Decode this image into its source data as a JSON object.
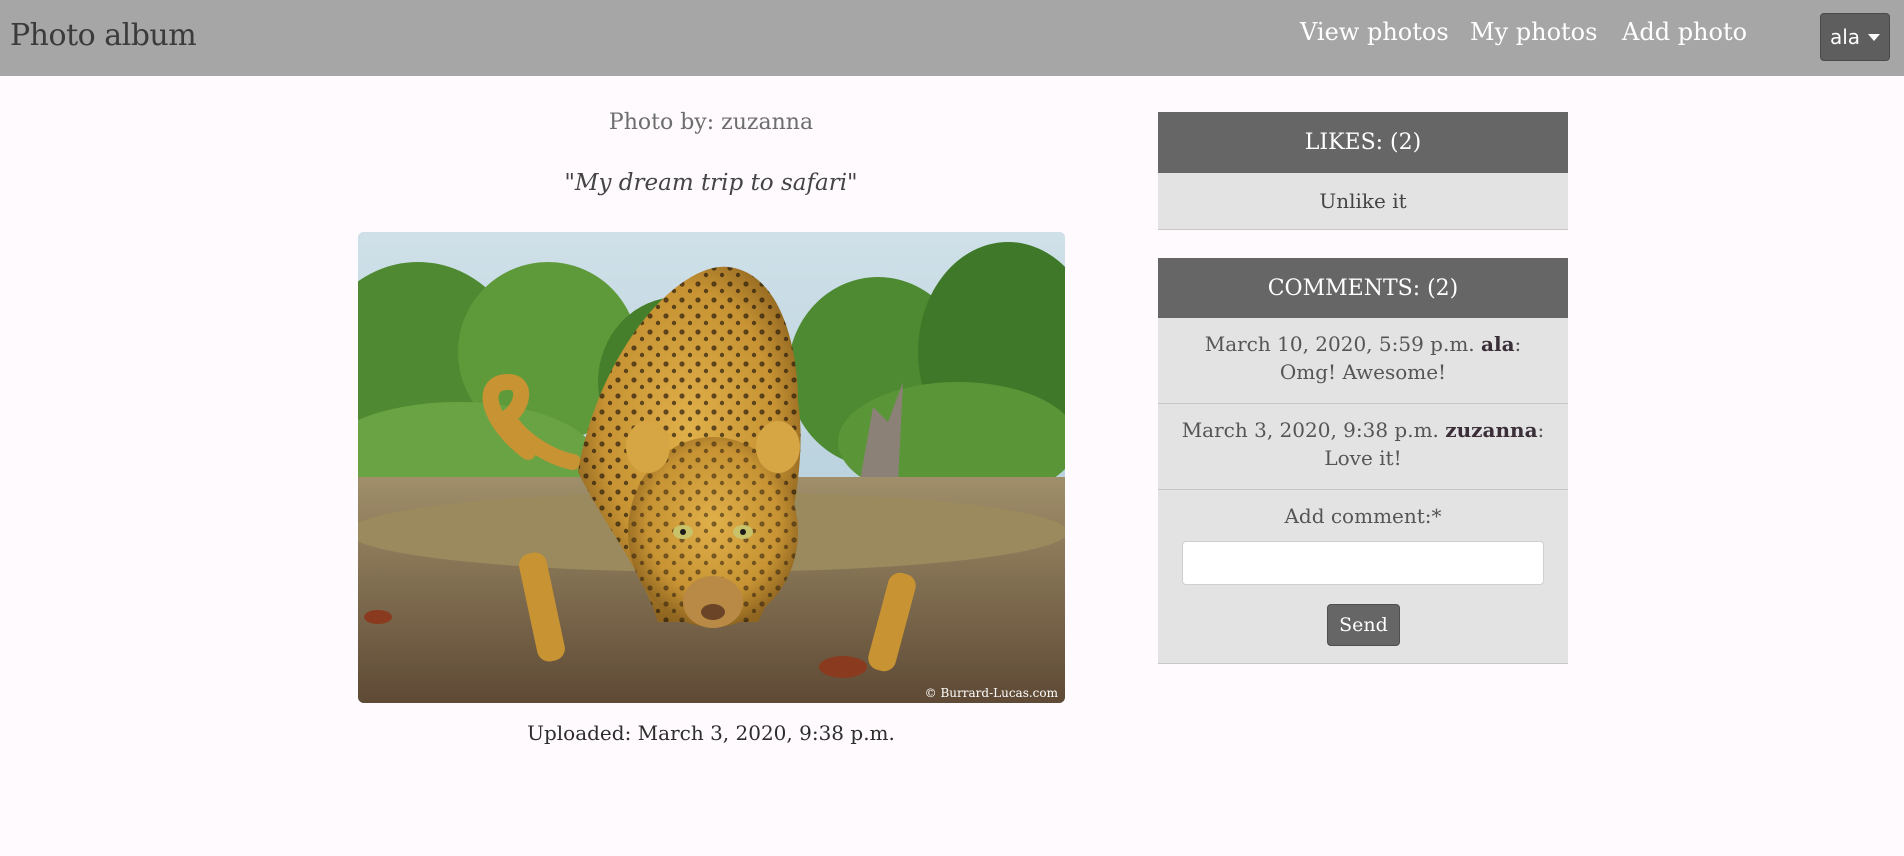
{
  "navbar": {
    "brand": "Photo album",
    "links": [
      "View photos",
      "My photos",
      "Add photo"
    ],
    "user": "ala"
  },
  "photo": {
    "author_line": "Photo by: zuzanna",
    "title": "\"My dream trip to safari\"",
    "watermark": "© Burrard-Lucas.com",
    "uploaded": "Uploaded: March 3, 2020, 9:38 p.m."
  },
  "likes": {
    "header": "LIKES: (2)",
    "action": "Unlike it"
  },
  "comments": {
    "header": "COMMENTS: (2)",
    "items": [
      {
        "date": "March 10, 2020, 5:59 p.m.",
        "author": "ala",
        "text": ": Omg! Awesome!"
      },
      {
        "date": "March 3, 2020, 9:38 p.m.",
        "author": "zuzanna",
        "text": ": Love it!"
      }
    ],
    "add_label": "Add comment:*",
    "input_value": "",
    "send_label": "Send"
  },
  "colors": {
    "navbar": "#a6a6a6",
    "panel_header": "#666666",
    "panel_body": "#e3e3e3",
    "page_bg": "#fefafd"
  },
  "icons": {
    "user_menu": "caret-down-icon"
  }
}
